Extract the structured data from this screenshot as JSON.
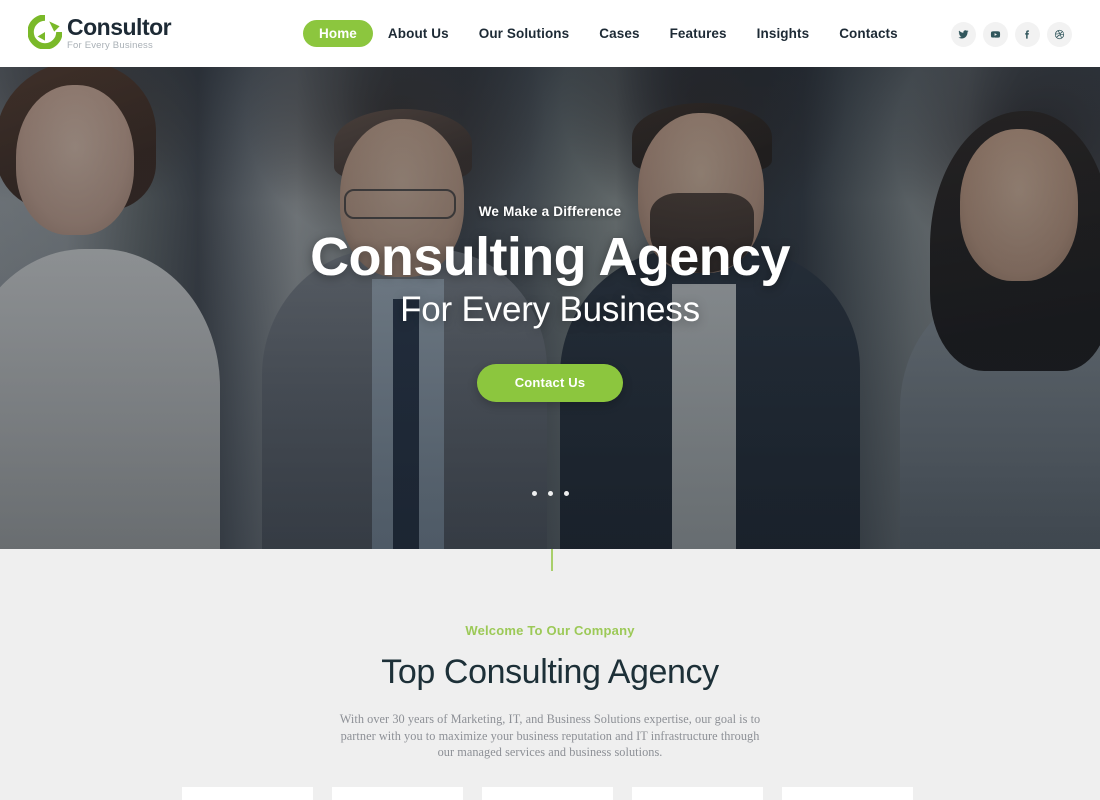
{
  "brand": {
    "name": "Consultor",
    "tagline": "For Every Business",
    "logo_icon": "circular-c-arrow-logo",
    "accent_green": "#8cc63e",
    "eyebrow_green": "#9cc957",
    "dark_text": "#1d2a35"
  },
  "nav": {
    "items": [
      {
        "label": "Home",
        "active": true
      },
      {
        "label": "About Us",
        "active": false
      },
      {
        "label": "Our Solutions",
        "active": false
      },
      {
        "label": "Cases",
        "active": false
      },
      {
        "label": "Features",
        "active": false
      },
      {
        "label": "Insights",
        "active": false
      },
      {
        "label": "Contacts",
        "active": false
      }
    ]
  },
  "socials": [
    {
      "name": "twitter-icon",
      "title": "Twitter"
    },
    {
      "name": "youtube-icon",
      "title": "YouTube"
    },
    {
      "name": "facebook-icon",
      "title": "Facebook"
    },
    {
      "name": "dribbble-icon",
      "title": "Dribbble"
    }
  ],
  "hero": {
    "eyebrow": "We Make a Difference",
    "title": "Consulting Agency",
    "subtitle": "For Every Business",
    "cta_label": "Contact Us",
    "slides": 3,
    "active_slide": 1
  },
  "welcome": {
    "eyebrow": "Welcome To Our Company",
    "title": "Top Consulting Agency",
    "description": "With over 30 years of Marketing, IT, and Business Solutions expertise, our goal is to partner with you to maximize your business reputation and IT infrastructure through our managed services and business solutions."
  },
  "feature_cards": [
    {
      "index": 1
    },
    {
      "index": 2
    },
    {
      "index": 3
    },
    {
      "index": 4
    },
    {
      "index": 5
    }
  ]
}
